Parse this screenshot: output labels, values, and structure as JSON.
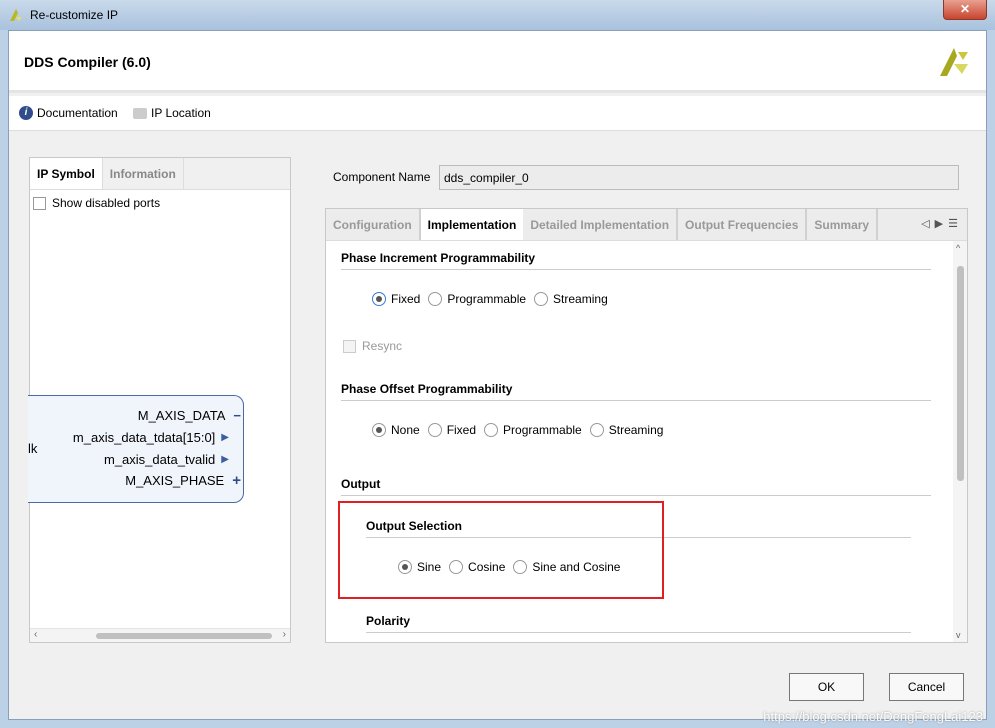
{
  "window": {
    "title": "Re-customize IP",
    "close": "✕"
  },
  "header": {
    "title": "DDS Compiler (6.0)"
  },
  "links": {
    "documentation": "Documentation",
    "ip_location": "IP Location"
  },
  "left": {
    "tabs": [
      "IP Symbol",
      "Information"
    ],
    "show_disabled": "Show disabled ports",
    "clk_label": "lk",
    "ports": [
      "M_AXIS_DATA",
      "m_axis_data_tdata[15:0]",
      "m_axis_data_tvalid",
      "M_AXIS_PHASE"
    ]
  },
  "component": {
    "label": "Component Name",
    "value": "dds_compiler_0"
  },
  "tabs": [
    "Configuration",
    "Implementation",
    "Detailed Implementation",
    "Output Frequencies",
    "Summary"
  ],
  "sections": {
    "phase_inc": {
      "title": "Phase Increment Programmability",
      "options": [
        "Fixed",
        "Programmable",
        "Streaming"
      ],
      "selected": "Fixed"
    },
    "resync": "Resync",
    "phase_off": {
      "title": "Phase Offset Programmability",
      "options": [
        "None",
        "Fixed",
        "Programmable",
        "Streaming"
      ],
      "selected": "None"
    },
    "output": {
      "title": "Output"
    },
    "output_sel": {
      "title": "Output Selection",
      "options": [
        "Sine",
        "Cosine",
        "Sine and Cosine"
      ],
      "selected": "Sine"
    },
    "polarity": {
      "title": "Polarity"
    }
  },
  "buttons": {
    "ok": "OK",
    "cancel": "Cancel"
  },
  "watermark": "https://blog.csdn.net/DengFengLai123",
  "colors": {
    "highlight_box": "#e02020",
    "accent": "#3a7bd5"
  }
}
